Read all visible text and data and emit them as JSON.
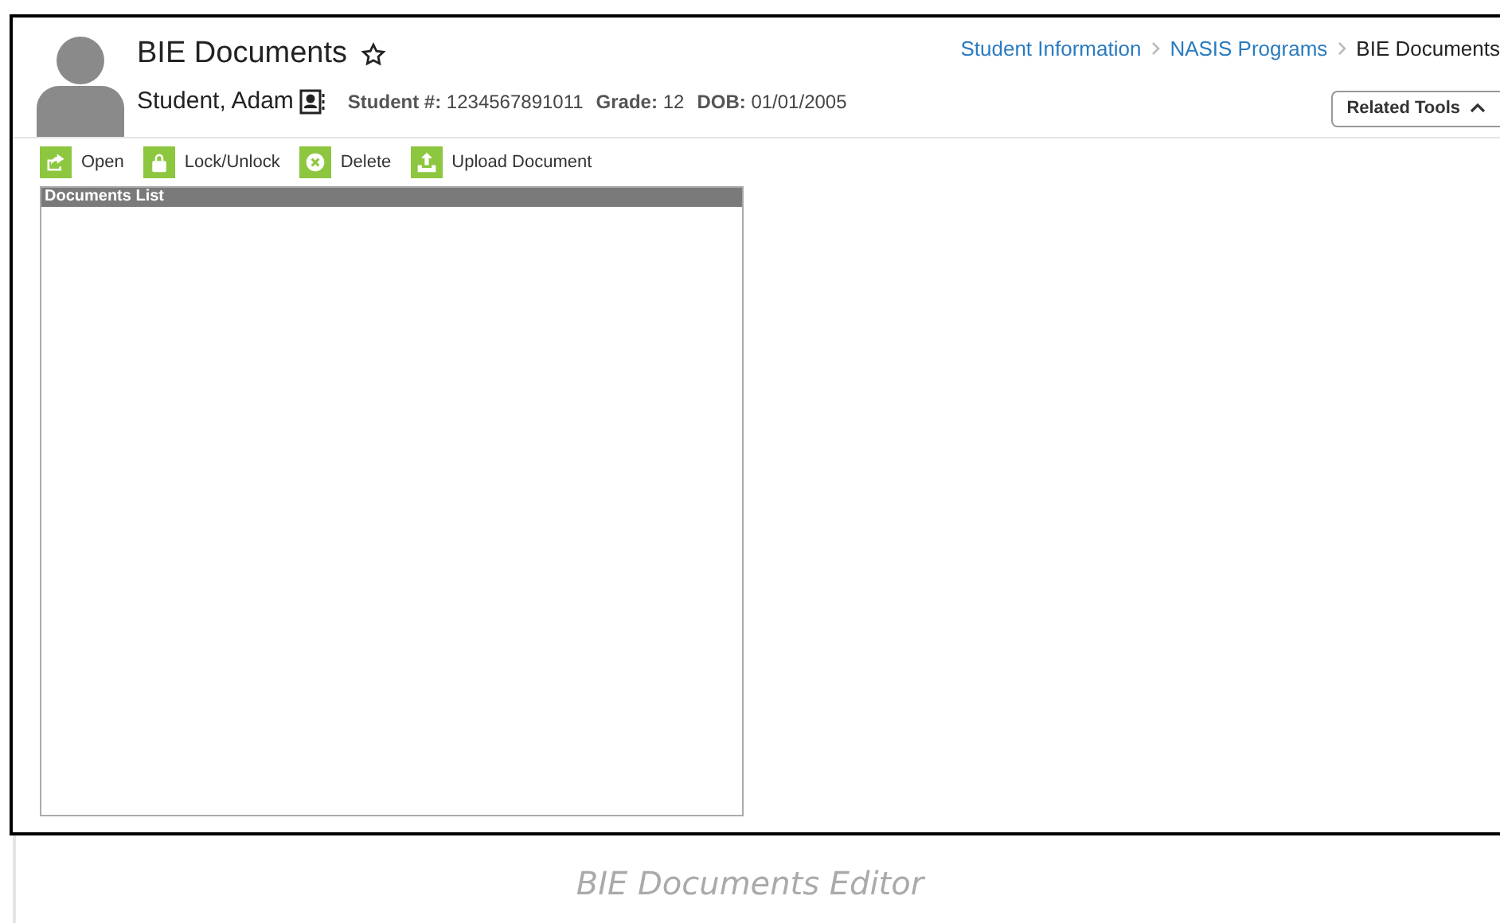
{
  "header": {
    "title": "BIE Documents",
    "student_name": "Student, Adam",
    "fields": [
      {
        "label": "Student #:",
        "value": "1234567891011"
      },
      {
        "label": "Grade:",
        "value": "12"
      },
      {
        "label": "DOB:",
        "value": "01/01/2005"
      }
    ]
  },
  "breadcrumbs": [
    {
      "label": "Student Information",
      "kind": "link"
    },
    {
      "label": "NASIS Programs",
      "kind": "link"
    },
    {
      "label": "BIE Documents",
      "kind": "current"
    }
  ],
  "related_tools": {
    "label": "Related Tools",
    "expanded": true
  },
  "toolbar": [
    {
      "label": "Open",
      "kind": "open"
    },
    {
      "label": "Lock/Unlock",
      "kind": "lock"
    },
    {
      "label": "Delete",
      "kind": "delete"
    },
    {
      "label": "Upload Document",
      "kind": "upload"
    }
  ],
  "documents_list": {
    "title": "Documents List"
  },
  "caption": "BIE Documents Editor"
}
